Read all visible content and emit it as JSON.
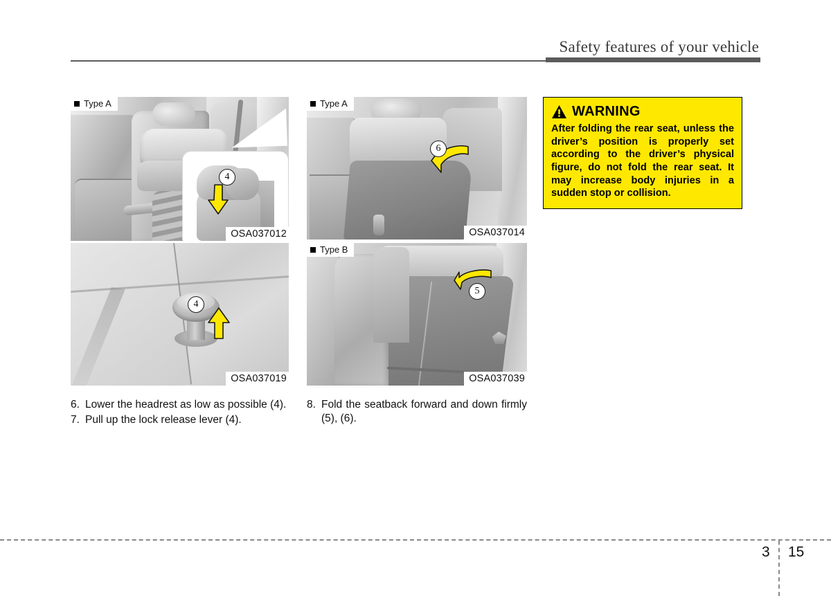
{
  "header": {
    "title": "Safety features of your vehicle"
  },
  "figures": {
    "top_left": {
      "type_label": "Type A",
      "code": "OSA037012",
      "callout": "4",
      "arrow": "down-arrow-yellow",
      "description": "Rear seat headrest lowering, inset detail view"
    },
    "bottom_left": {
      "code": "OSA037019",
      "callout": "4",
      "arrow": "up-arrow-yellow",
      "description": "Lock release lever knob"
    },
    "top_mid": {
      "type_label": "Type A",
      "code": "OSA037014",
      "callout": "6",
      "arrow": "curved-down-arrow-yellow",
      "description": "Rear seatback folded forward and down, Type A"
    },
    "bottom_mid": {
      "type_label": "Type B",
      "code": "OSA037039",
      "callout": "5",
      "arrow": "curved-left-arrow-yellow",
      "description": "Rear seatback folded forward and down, Type B"
    }
  },
  "steps_left": [
    {
      "num": "6.",
      "text": "Lower the headrest as low as possible (4)."
    },
    {
      "num": "7.",
      "text": "Pull up the lock release lever (4)."
    }
  ],
  "steps_mid": [
    {
      "num": "8.",
      "text": "Fold the seatback forward and down firmly (5), (6)."
    }
  ],
  "warning": {
    "icon": "warning-triangle-icon",
    "title": "WARNING",
    "body": "After folding the rear seat, unless the driver’s position is properly set according to the driver’s physical figure, do not fold the rear seat. It may increase body injuries in a sudden stop or collision.",
    "background_color": "#ffe800",
    "border_color": "#000000"
  },
  "footer": {
    "chapter": "3",
    "page": "15"
  }
}
